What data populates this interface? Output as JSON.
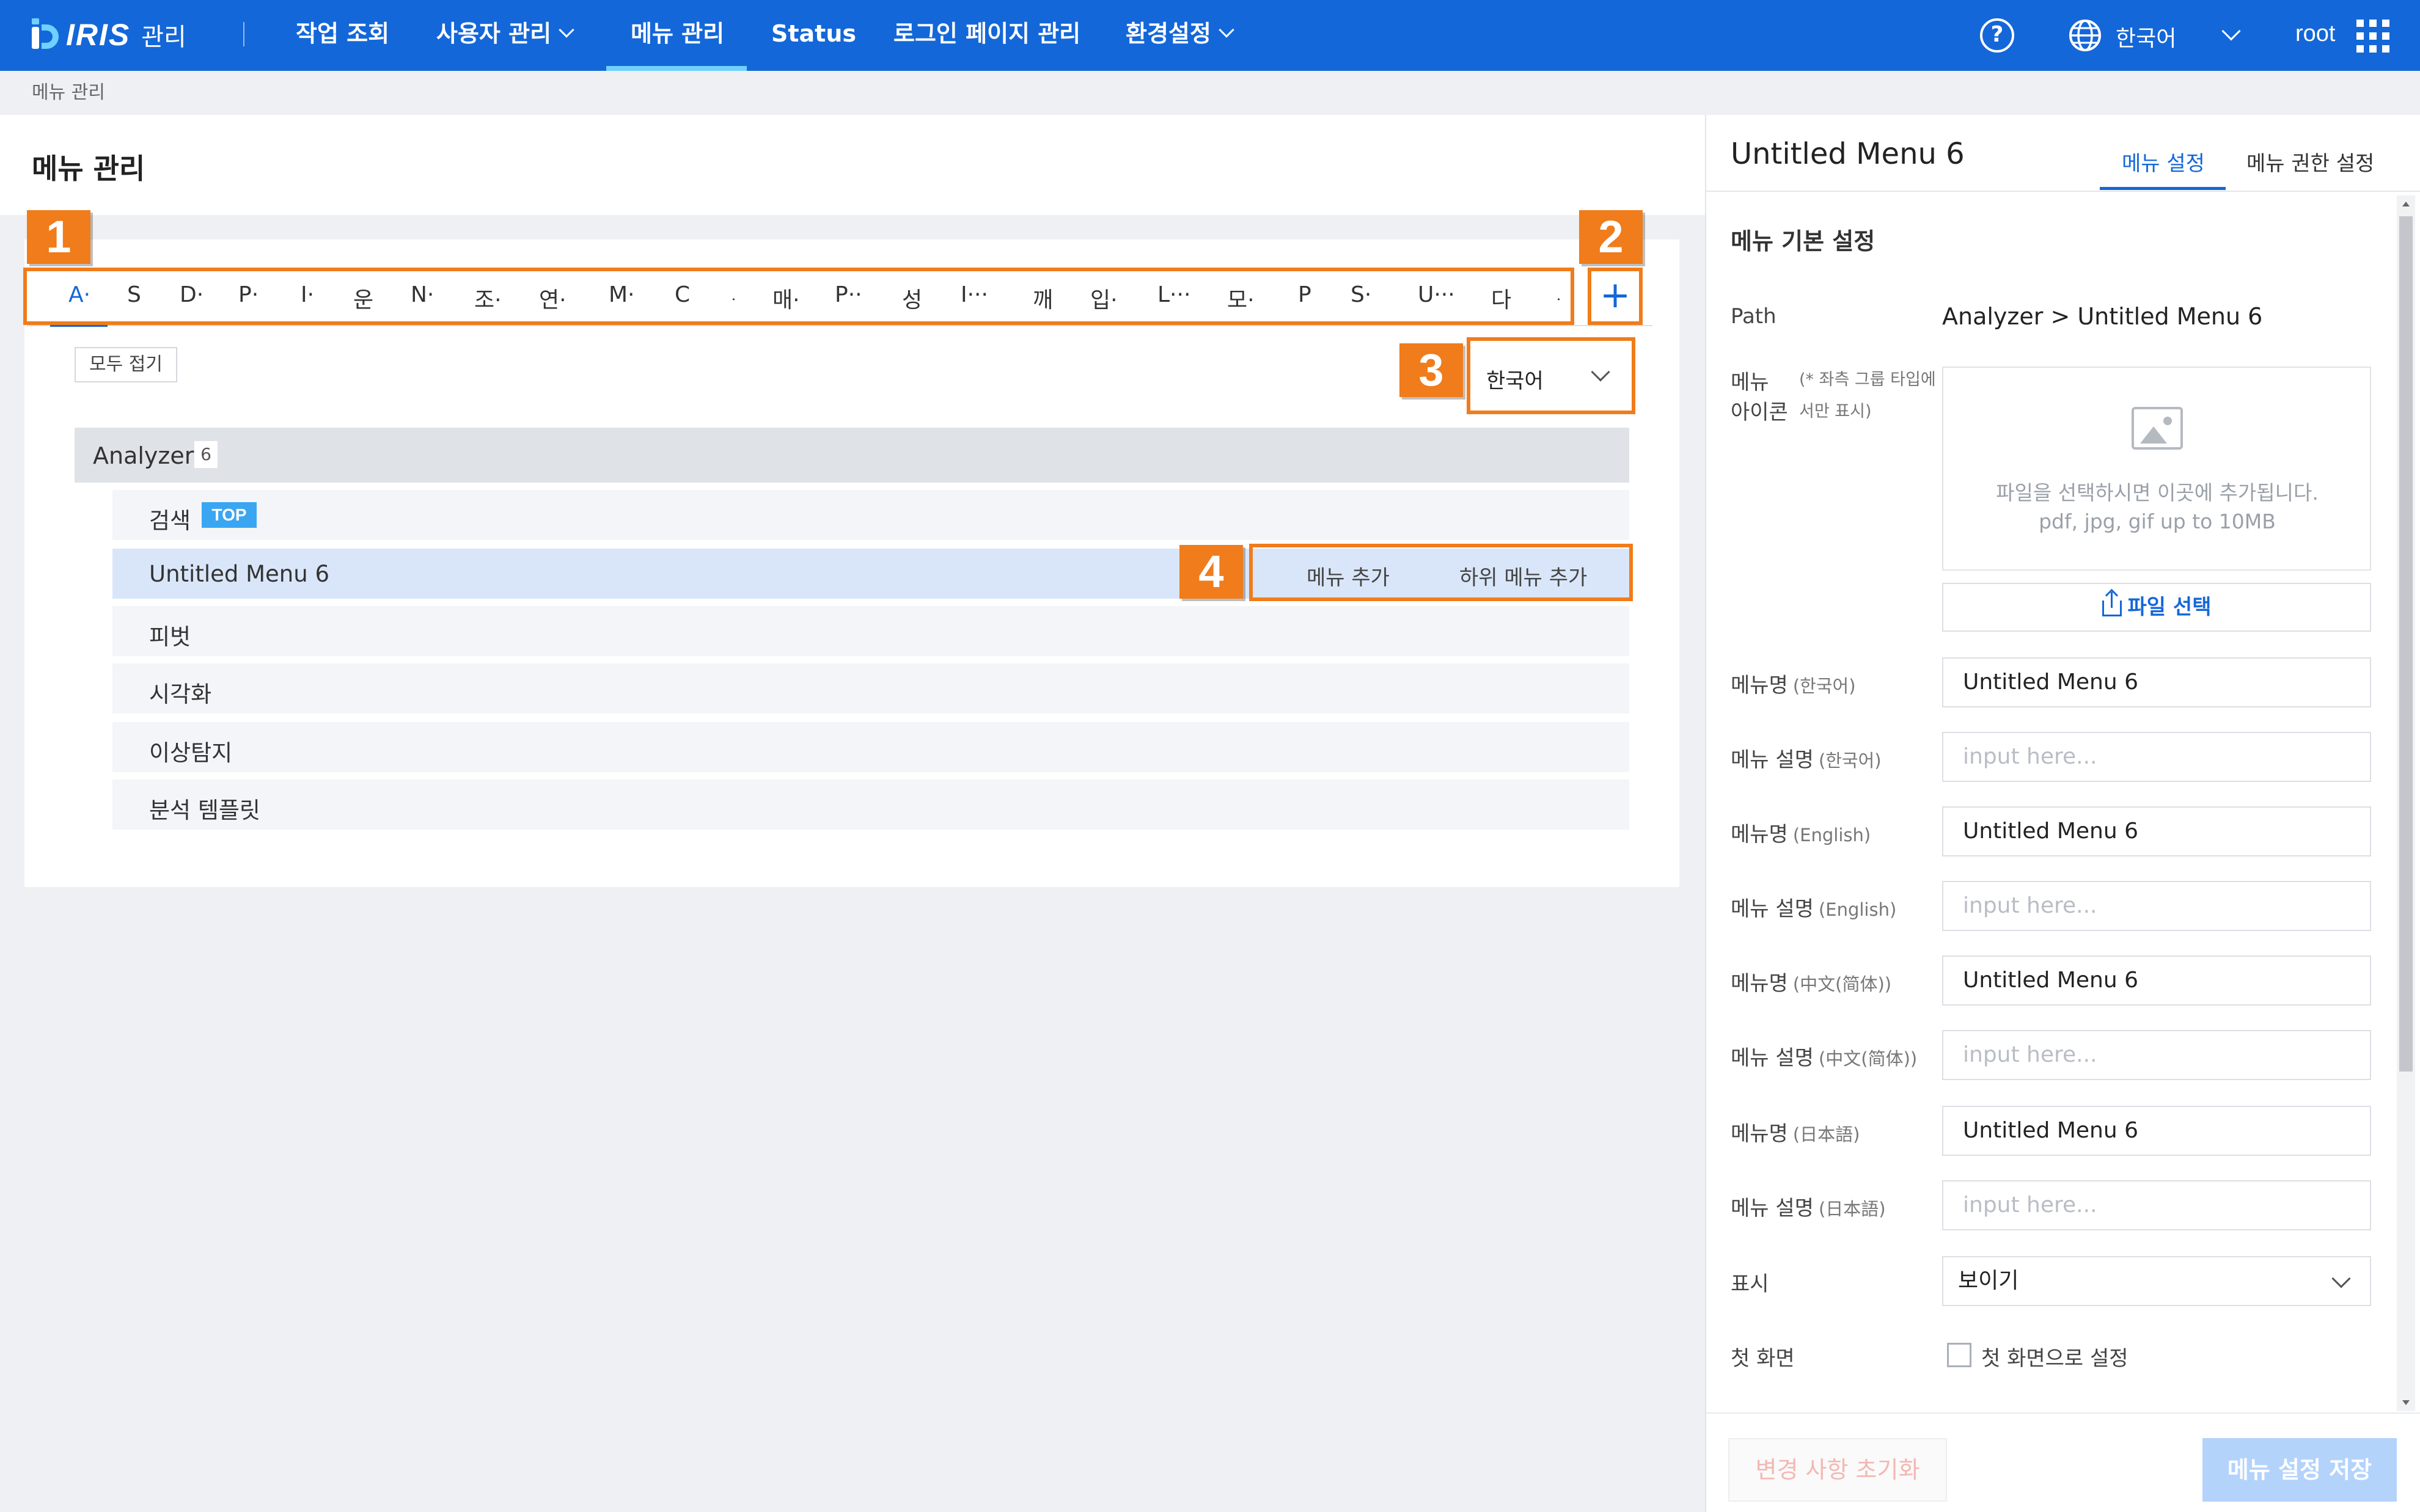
{
  "header": {
    "logo_text": "IRIS",
    "logo_sub": "관리",
    "nav": [
      {
        "label": "작업 조회",
        "dropdown": false
      },
      {
        "label": "사용자 관리",
        "dropdown": true
      },
      {
        "label": "메뉴 관리",
        "dropdown": false,
        "active": true
      },
      {
        "label": "Status",
        "dropdown": false
      },
      {
        "label": "로그인 페이지 관리",
        "dropdown": false
      },
      {
        "label": "환경설정",
        "dropdown": true
      }
    ],
    "help_icon": "?",
    "language": "한국어",
    "user": "root"
  },
  "breadcrumb": "메뉴 관리",
  "page": {
    "title": "메뉴 관리"
  },
  "badges": [
    "1",
    "2",
    "3",
    "4"
  ],
  "menu_tabs": [
    "A·",
    "S",
    "D·",
    "P·",
    "I·",
    "운",
    "N·",
    "조·",
    "연·",
    "M·",
    "C",
    "ᆞ",
    "매·",
    "P··",
    "성",
    "I···",
    "깨",
    "입·",
    "L···",
    "모·",
    "P",
    "S·",
    "U···",
    "다",
    "ᆞ"
  ],
  "add_tab_symbol": "+",
  "tree": {
    "fold_all_label": "모두 접기",
    "language_select": "한국어",
    "group": {
      "label": "Analyzer",
      "count": "6"
    },
    "items": [
      {
        "label": "검색",
        "tag": "TOP"
      },
      {
        "label": "Untitled Menu 6",
        "selected": true
      },
      {
        "label": "피벗"
      },
      {
        "label": "시각화"
      },
      {
        "label": "이상탐지"
      },
      {
        "label": "분석 템플릿"
      }
    ],
    "row_actions": {
      "add_menu": "메뉴 추가",
      "add_submenu": "하위 메뉴 추가"
    }
  },
  "right_panel": {
    "title": "Untitled Menu 6",
    "tabs": [
      "메뉴 설정",
      "메뉴 권한 설정"
    ],
    "section_title": "메뉴 기본 설정",
    "path_label": "Path",
    "path_value": "Analyzer > Untitled Menu 6",
    "icon_label_1": "메뉴",
    "icon_label_2": "아이콘",
    "icon_note": "(* 좌측 그룹 타입에서만 표시)",
    "upload_text_1": "파일을 선택하시면 이곳에 추가됩니다.",
    "upload_text_2": "pdf, jpg, gif up to 10MB",
    "file_button": "파일 선택",
    "fields": [
      {
        "label": "메뉴명",
        "sub": "(한국어)",
        "value": "Untitled Menu 6",
        "placeholder": false
      },
      {
        "label": "메뉴 설명",
        "sub": "(한국어)",
        "value": "input here...",
        "placeholder": true
      },
      {
        "label": "메뉴명",
        "sub": "(English)",
        "value": "Untitled Menu 6",
        "placeholder": false
      },
      {
        "label": "메뉴 설명",
        "sub": "(English)",
        "value": "input here...",
        "placeholder": true
      },
      {
        "label": "메뉴명",
        "sub": "(中文(简体))",
        "value": "Untitled Menu 6",
        "placeholder": false
      },
      {
        "label": "메뉴 설명",
        "sub": "(中文(简体))",
        "value": "input here...",
        "placeholder": true
      },
      {
        "label": "메뉴명",
        "sub": "(日本語)",
        "value": "Untitled Menu 6",
        "placeholder": false
      },
      {
        "label": "메뉴 설명",
        "sub": "(日本語)",
        "value": "input here...",
        "placeholder": true
      }
    ],
    "display_label": "표시",
    "display_value": "보이기",
    "first_screen_label": "첫 화면",
    "first_screen_checkbox": "첫 화면으로 설정",
    "reset_button": "변경 사항 초기화",
    "save_button": "메뉴 설정 저장"
  },
  "colors": {
    "primary": "#1467d8",
    "accent": "#6fd1ff",
    "highlight": "#f07c1b",
    "selected_row": "#d9e6fa",
    "tag": "#3aa6f2"
  }
}
